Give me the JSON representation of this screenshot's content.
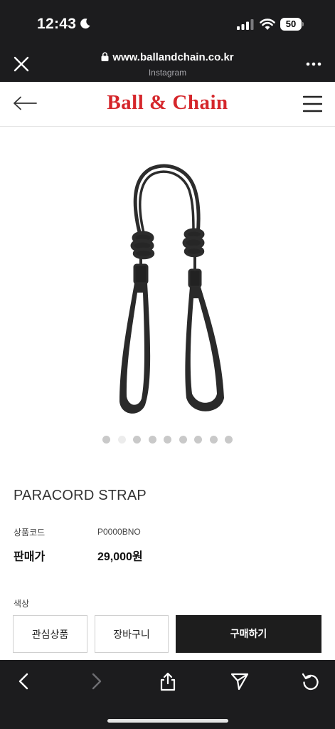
{
  "status_bar": {
    "time": "12:43",
    "battery": "50",
    "icons": [
      "moon-icon",
      "signal-icon",
      "wifi-icon",
      "battery-icon"
    ]
  },
  "browser": {
    "url": "www.ballandchain.co.kr",
    "subtitle": "Instagram",
    "icons": [
      "close-icon",
      "lock-icon",
      "more-icon"
    ]
  },
  "site_header": {
    "logo": "Ball & Chain",
    "icons": [
      "back-arrow-icon",
      "hamburger-menu-icon"
    ],
    "logo_color": "#d5262b"
  },
  "gallery": {
    "slide_count": 9,
    "active_index": 1
  },
  "product": {
    "name": "PARACORD STRAP",
    "code_label": "상품코드",
    "code_value": "P0000BNO",
    "price_label": "판매가",
    "price_value": "29,000원",
    "color_label": "색상"
  },
  "actions": {
    "wishlist": "관심상품",
    "cart": "장바구니",
    "buy": "구매하기"
  },
  "toolbar": {
    "icons": [
      "back-icon",
      "forward-icon",
      "share-icon",
      "send-icon",
      "reload-icon"
    ]
  },
  "colors": {
    "chrome": "#1c1c1e",
    "buy_button": "#1d1d1d"
  }
}
